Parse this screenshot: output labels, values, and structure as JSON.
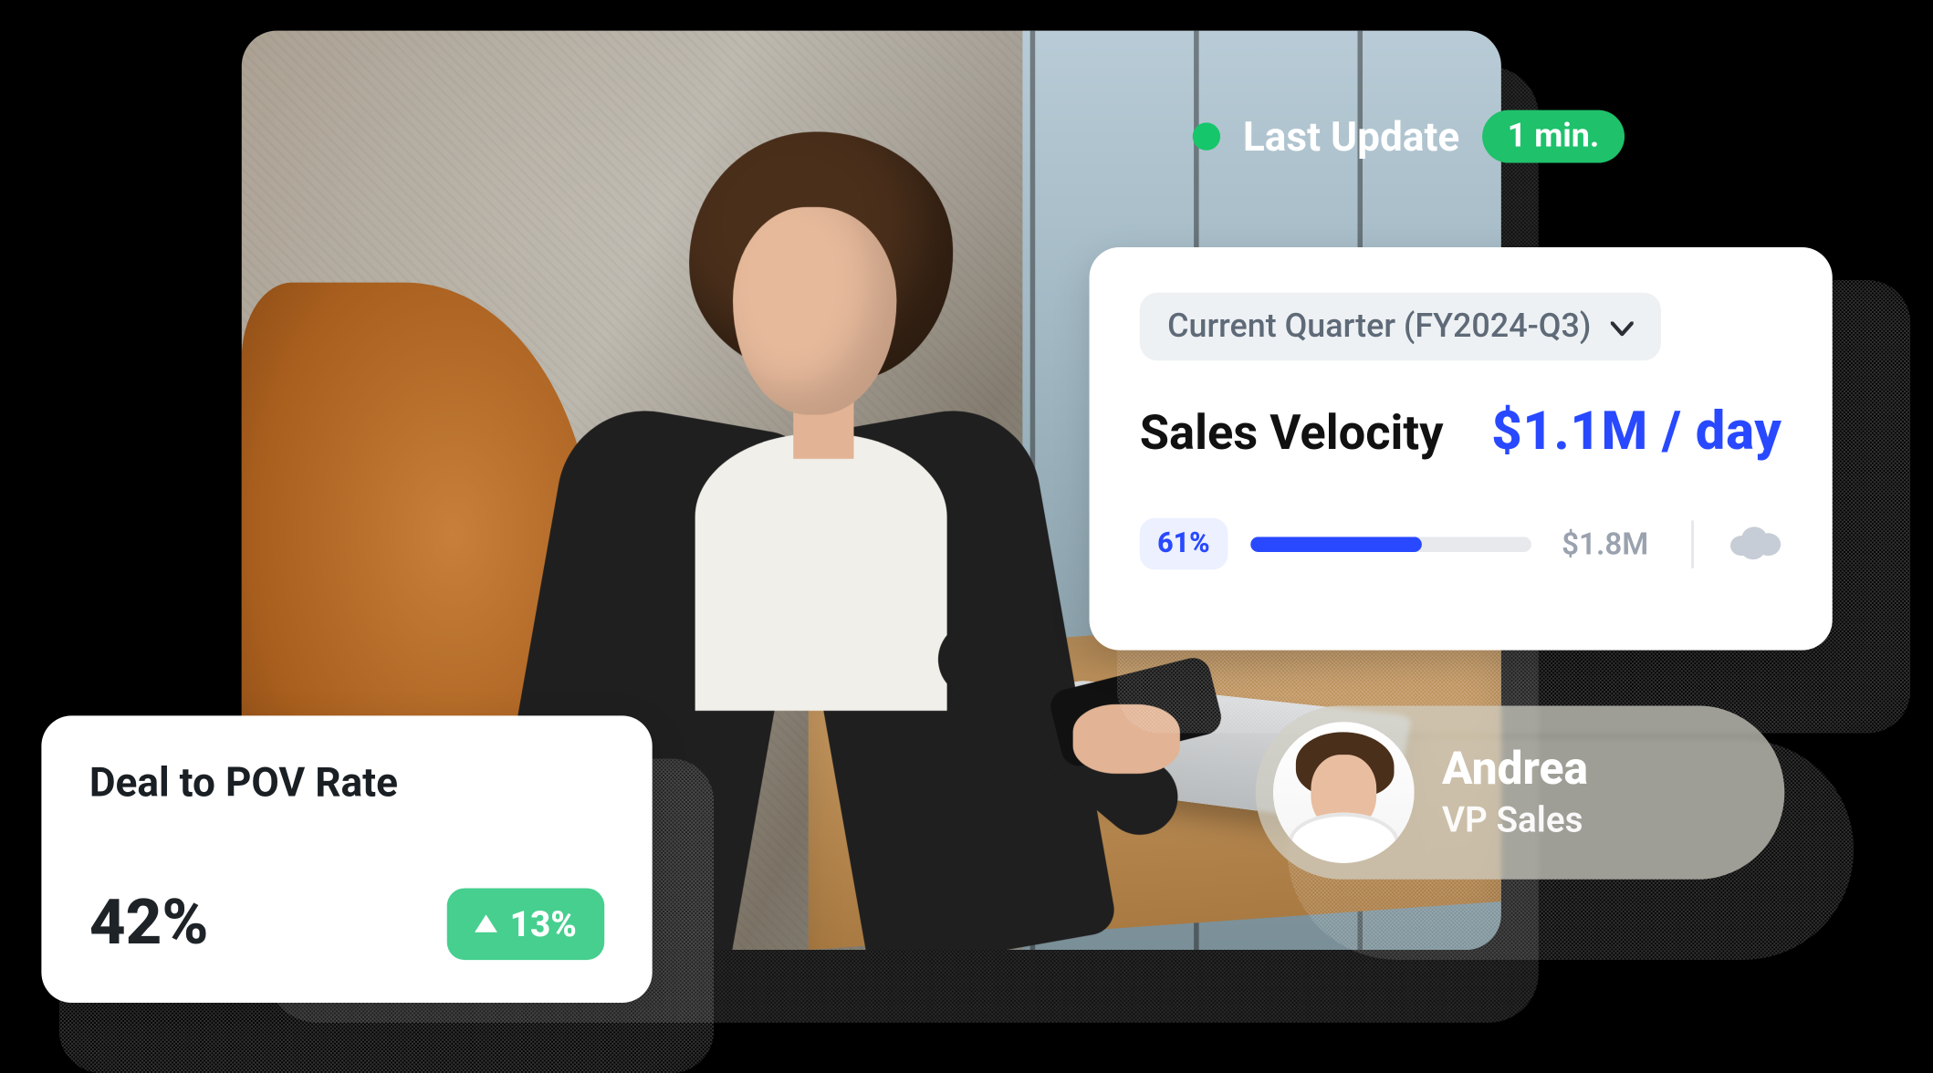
{
  "status": {
    "label": "Last Update",
    "value": "1 min."
  },
  "velocity_card": {
    "period_select": "Current Quarter (FY2024-Q3)",
    "metric_label": "Sales Velocity",
    "metric_value": "$1.1M / day",
    "progress_percent_label": "61%",
    "progress_percent": 61,
    "target": "$1.8M",
    "source_icon": "salesforce"
  },
  "pov_card": {
    "title": "Deal to POV Rate",
    "value": "42%",
    "delta": "13%",
    "delta_direction": "up"
  },
  "user": {
    "name": "Andrea",
    "role": "VP Sales"
  },
  "colors": {
    "accent_blue": "#2849ff",
    "accent_green": "#1fc16b",
    "positive_green": "#46cf8e"
  }
}
